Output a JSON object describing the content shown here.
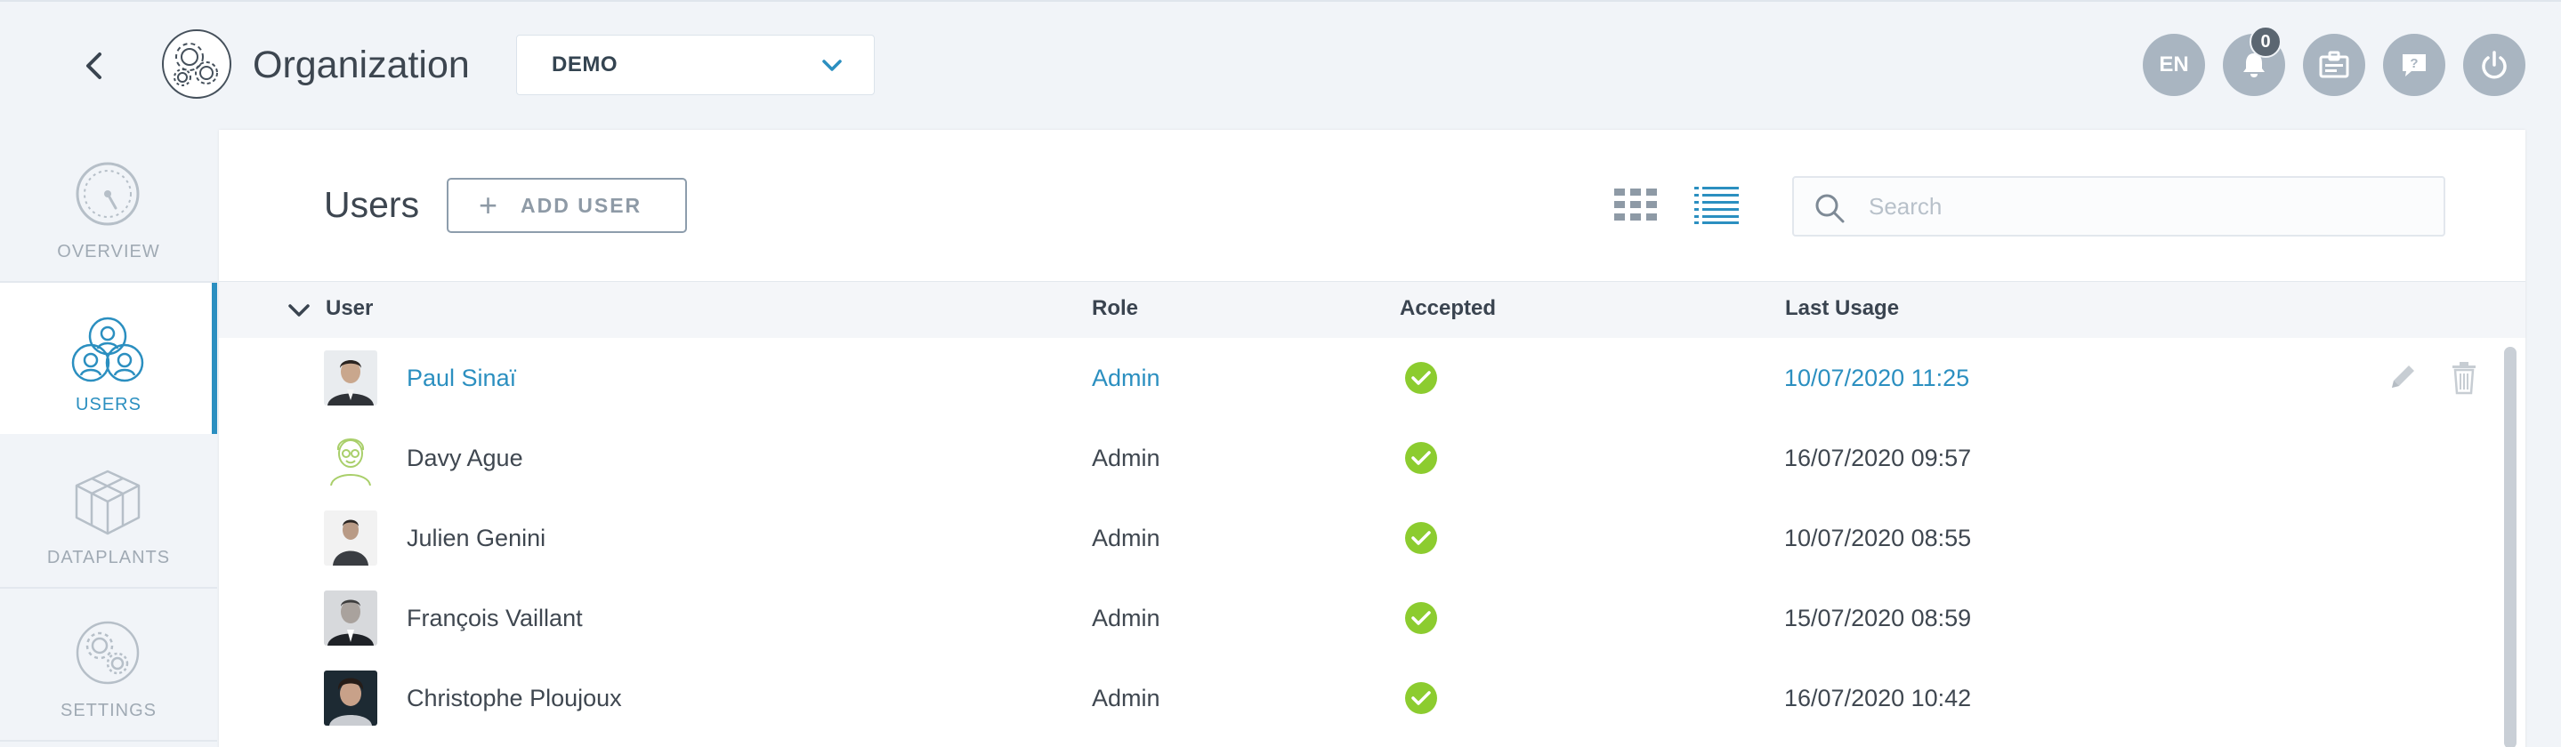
{
  "header": {
    "title": "Organization",
    "org_select_value": "DEMO",
    "language": "EN",
    "notification_count": "0"
  },
  "sidebar": {
    "items": [
      {
        "label": "OVERVIEW",
        "icon": "dashboard-gauge-icon"
      },
      {
        "label": "USERS",
        "icon": "users-group-icon",
        "active": true
      },
      {
        "label": "DATAPLANTS",
        "icon": "cubes-icon"
      },
      {
        "label": "SETTINGS",
        "icon": "gears-icon"
      }
    ]
  },
  "main": {
    "title": "Users",
    "add_user_label": "ADD USER",
    "search_placeholder": "Search",
    "columns": {
      "user": "User",
      "role": "Role",
      "accepted": "Accepted",
      "last_usage": "Last Usage"
    },
    "rows": [
      {
        "name": "Paul Sinaï",
        "role": "Admin",
        "accepted": true,
        "last_usage": "10/07/2020 11:25"
      },
      {
        "name": "Davy Ague",
        "role": "Admin",
        "accepted": true,
        "last_usage": "16/07/2020 09:57"
      },
      {
        "name": "Julien Genini",
        "role": "Admin",
        "accepted": true,
        "last_usage": "10/07/2020 08:55"
      },
      {
        "name": "François Vaillant",
        "role": "Admin",
        "accepted": true,
        "last_usage": "15/07/2020 08:59"
      },
      {
        "name": "Christophe Ploujoux",
        "role": "Admin",
        "accepted": true,
        "last_usage": "16/07/2020 10:42"
      }
    ]
  },
  "colors": {
    "accent": "#2b8fc0",
    "success": "#8ccc2f",
    "header_button": "#a9b5c1",
    "background": "#f1f4f8"
  }
}
